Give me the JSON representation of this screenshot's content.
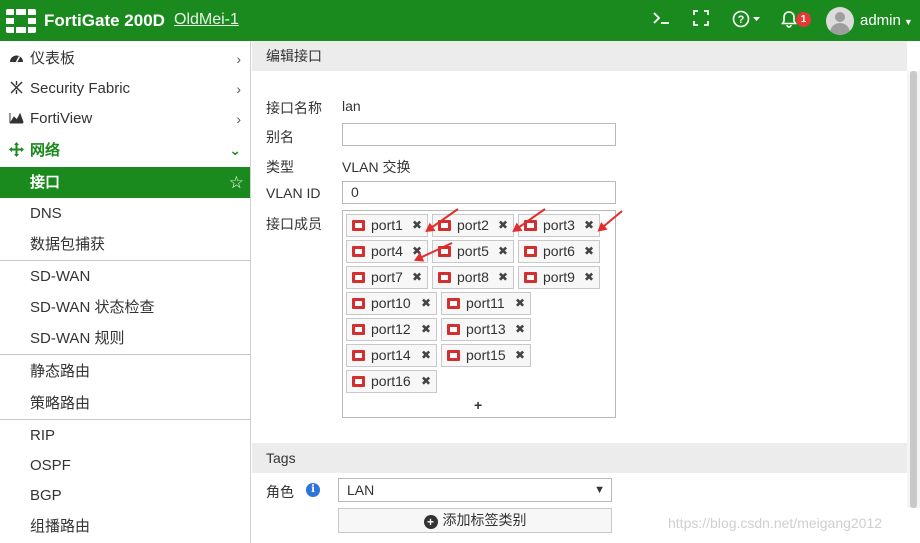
{
  "topbar": {
    "brand": "FortiGate 200D",
    "hostname": "OldMei-1",
    "terminal_icon": "terminal-icon",
    "fullscreen_icon": "fullscreen-icon",
    "help_icon": "help-icon",
    "bell_icon": "bell-icon",
    "notifications": "1",
    "user": "admin",
    "accent": "#1b8a1e"
  },
  "sidebar": {
    "items": [
      {
        "label": "仪表板",
        "icon": "dashboard-icon"
      },
      {
        "label": "Security Fabric",
        "icon": "security-fabric-icon"
      },
      {
        "label": "FortiView",
        "icon": "fortiview-icon"
      },
      {
        "label": "网络",
        "icon": "network-icon"
      },
      {
        "label": "接口"
      },
      {
        "label": "DNS"
      },
      {
        "label": "数据包捕获"
      },
      {
        "label": "SD-WAN"
      },
      {
        "label": "SD-WAN 状态检查"
      },
      {
        "label": "SD-WAN 规则"
      },
      {
        "label": "静态路由"
      },
      {
        "label": "策略路由"
      },
      {
        "label": "RIP"
      },
      {
        "label": "OSPF"
      },
      {
        "label": "BGP"
      },
      {
        "label": "组播路由"
      }
    ]
  },
  "main": {
    "section_title": "编辑接口",
    "fields": {
      "name_label": "接口名称",
      "name_value": "lan",
      "alias_label": "别名",
      "alias_value": "",
      "type_label": "类型",
      "type_value": "VLAN 交换",
      "vlan_label": "VLAN ID",
      "vlan_value": "0",
      "members_label": "接口成员"
    },
    "members": [
      "port1",
      "port2",
      "port3",
      "port4",
      "port5",
      "port6",
      "port7",
      "port8",
      "port9",
      "port10",
      "port11",
      "port12",
      "port13",
      "port14",
      "port15",
      "port16"
    ],
    "add_member": "+",
    "tags": {
      "title": "Tags",
      "role_label": "角色",
      "role_value": "LAN",
      "add_button": "添加标签类别"
    },
    "watermark": "https://blog.csdn.net/meigang2012"
  }
}
